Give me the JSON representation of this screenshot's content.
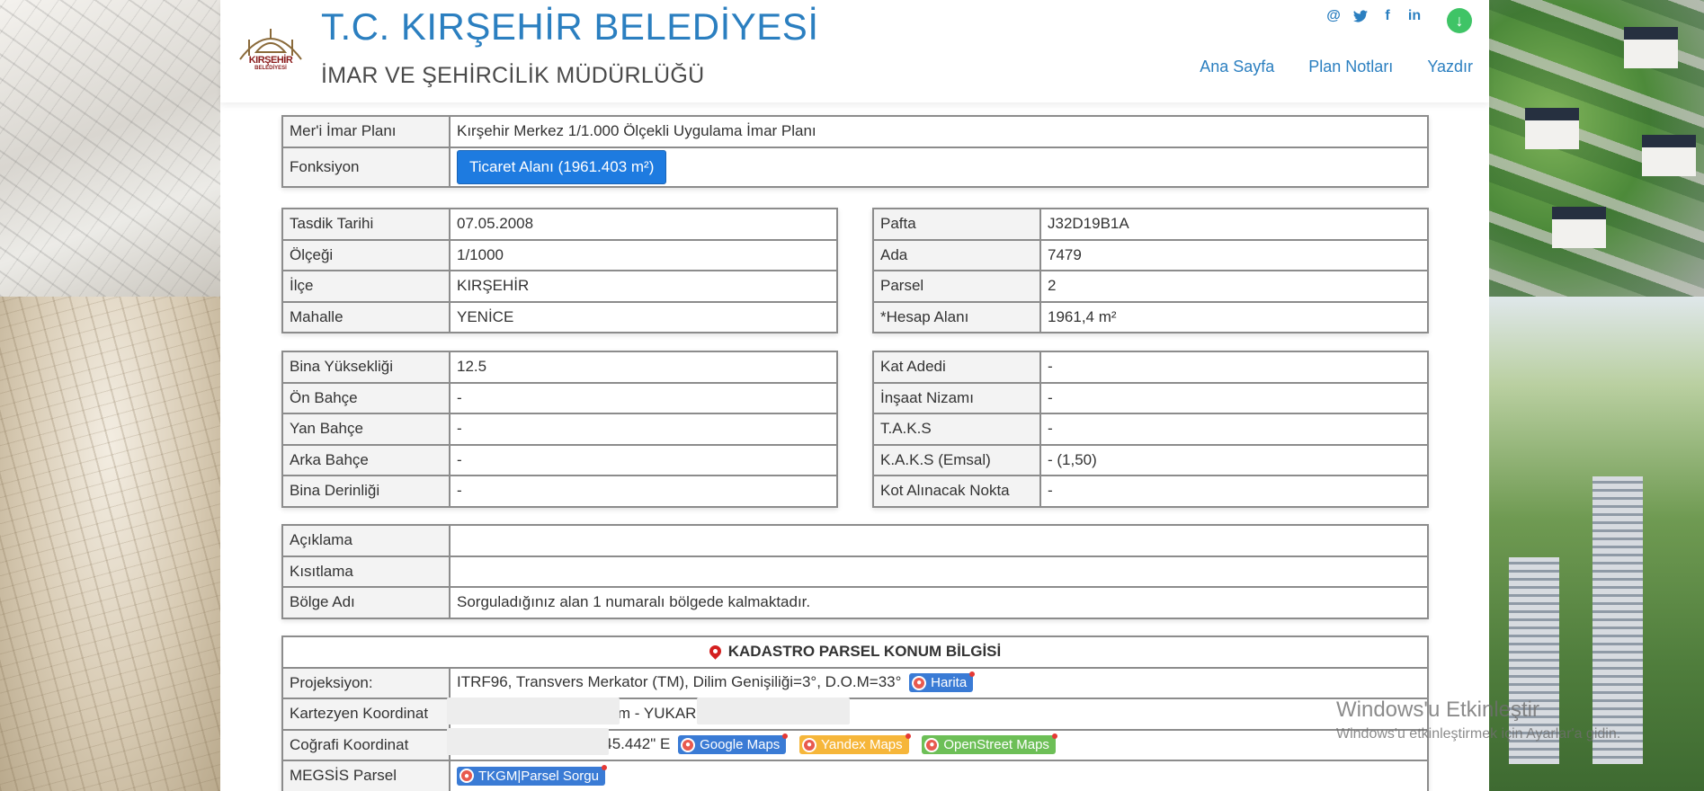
{
  "header": {
    "title": "T.C. KIRŞEHİR BELEDİYESİ",
    "subtitle": "İMAR VE ŞEHİRCİLİK MÜDÜRLÜĞÜ",
    "logo_text": "KIRŞEHİR",
    "logo_sub": "BELEDİYESİ",
    "social_icons": [
      "at-icon",
      "twitter-icon",
      "facebook-icon",
      "linkedin-icon"
    ],
    "nav": [
      "Ana Sayfa",
      "Plan Notları",
      "Yazdır"
    ]
  },
  "plan": {
    "rows": [
      {
        "label": "Mer'i İmar Planı",
        "value": "Kırşehir Merkez 1/1.000 Ölçekli Uygulama İmar Planı"
      },
      {
        "label": "Fonksiyon",
        "value": "Ticaret Alanı (1961.403 m²)"
      }
    ]
  },
  "info_left": [
    {
      "label": "Tasdik Tarihi",
      "value": "07.05.2008"
    },
    {
      "label": "Ölçeği",
      "value": "1/1000"
    },
    {
      "label": "İlçe",
      "value": "KIRŞEHİR"
    },
    {
      "label": "Mahalle",
      "value": "YENİCE"
    }
  ],
  "info_right": [
    {
      "label": "Pafta",
      "value": "J32D19B1A"
    },
    {
      "label": "Ada",
      "value": "7479"
    },
    {
      "label": "Parsel",
      "value": "2"
    },
    {
      "label": "*Hesap Alanı",
      "value": "1961,4 m²"
    }
  ],
  "build_left": [
    {
      "label": "Bina Yüksekliği",
      "value": "12.5"
    },
    {
      "label": "Ön Bahçe",
      "value": "-"
    },
    {
      "label": "Yan Bahçe",
      "value": "-"
    },
    {
      "label": "Arka Bahçe",
      "value": "-"
    },
    {
      "label": "Bina Derinliği",
      "value": "-"
    }
  ],
  "build_right": [
    {
      "label": "Kat Adedi",
      "value": "-"
    },
    {
      "label": "İnşaat Nizamı",
      "value": "-"
    },
    {
      "label": "T.A.K.S",
      "value": "-"
    },
    {
      "label": "K.A.K.S (Emsal)",
      "value": "- (1,50)"
    },
    {
      "label": "Kot Alınacak Nokta",
      "value": "-"
    }
  ],
  "notes": [
    {
      "label": "Açıklama",
      "value": ""
    },
    {
      "label": "Kısıtlama",
      "value": ""
    },
    {
      "label": "Bölge Adı",
      "value": "Sorguladığınız alan 1 numaralı bölgede kalmaktadır."
    }
  ],
  "kadastro": {
    "heading": "KADASTRO PARSEL KONUM BİLGİSİ",
    "rows": [
      {
        "label": "Projeksiyon:",
        "value": "ITRF96, Transvers Merkator (TM), Dilim Genişiliği=3°, D.O.M=33°"
      },
      {
        "label": "Kartezyen Koordinat",
        "value": "78m - YUKAR"
      },
      {
        "label": "Coğrafi Koordinat",
        "value": "'45.442\" E"
      },
      {
        "label": "MEGSİS Parsel",
        "value": ""
      }
    ],
    "buttons": {
      "harita": "Harita",
      "google": "Google Maps",
      "yandex": "Yandex Maps",
      "osm": "OpenStreet Maps",
      "tkgm": "TKGM|Parsel Sorgu"
    }
  },
  "windows_activation": {
    "line1": "Windows'u Etkinleştir",
    "line2": "Windows'u etkinleştirmek için Ayarlar'a gidin."
  },
  "colors": {
    "title_blue": "#2b7fc0",
    "button_blue": "#1e7be0",
    "kadastro_red": "#d41f1f",
    "download_green": "#3fc466"
  }
}
